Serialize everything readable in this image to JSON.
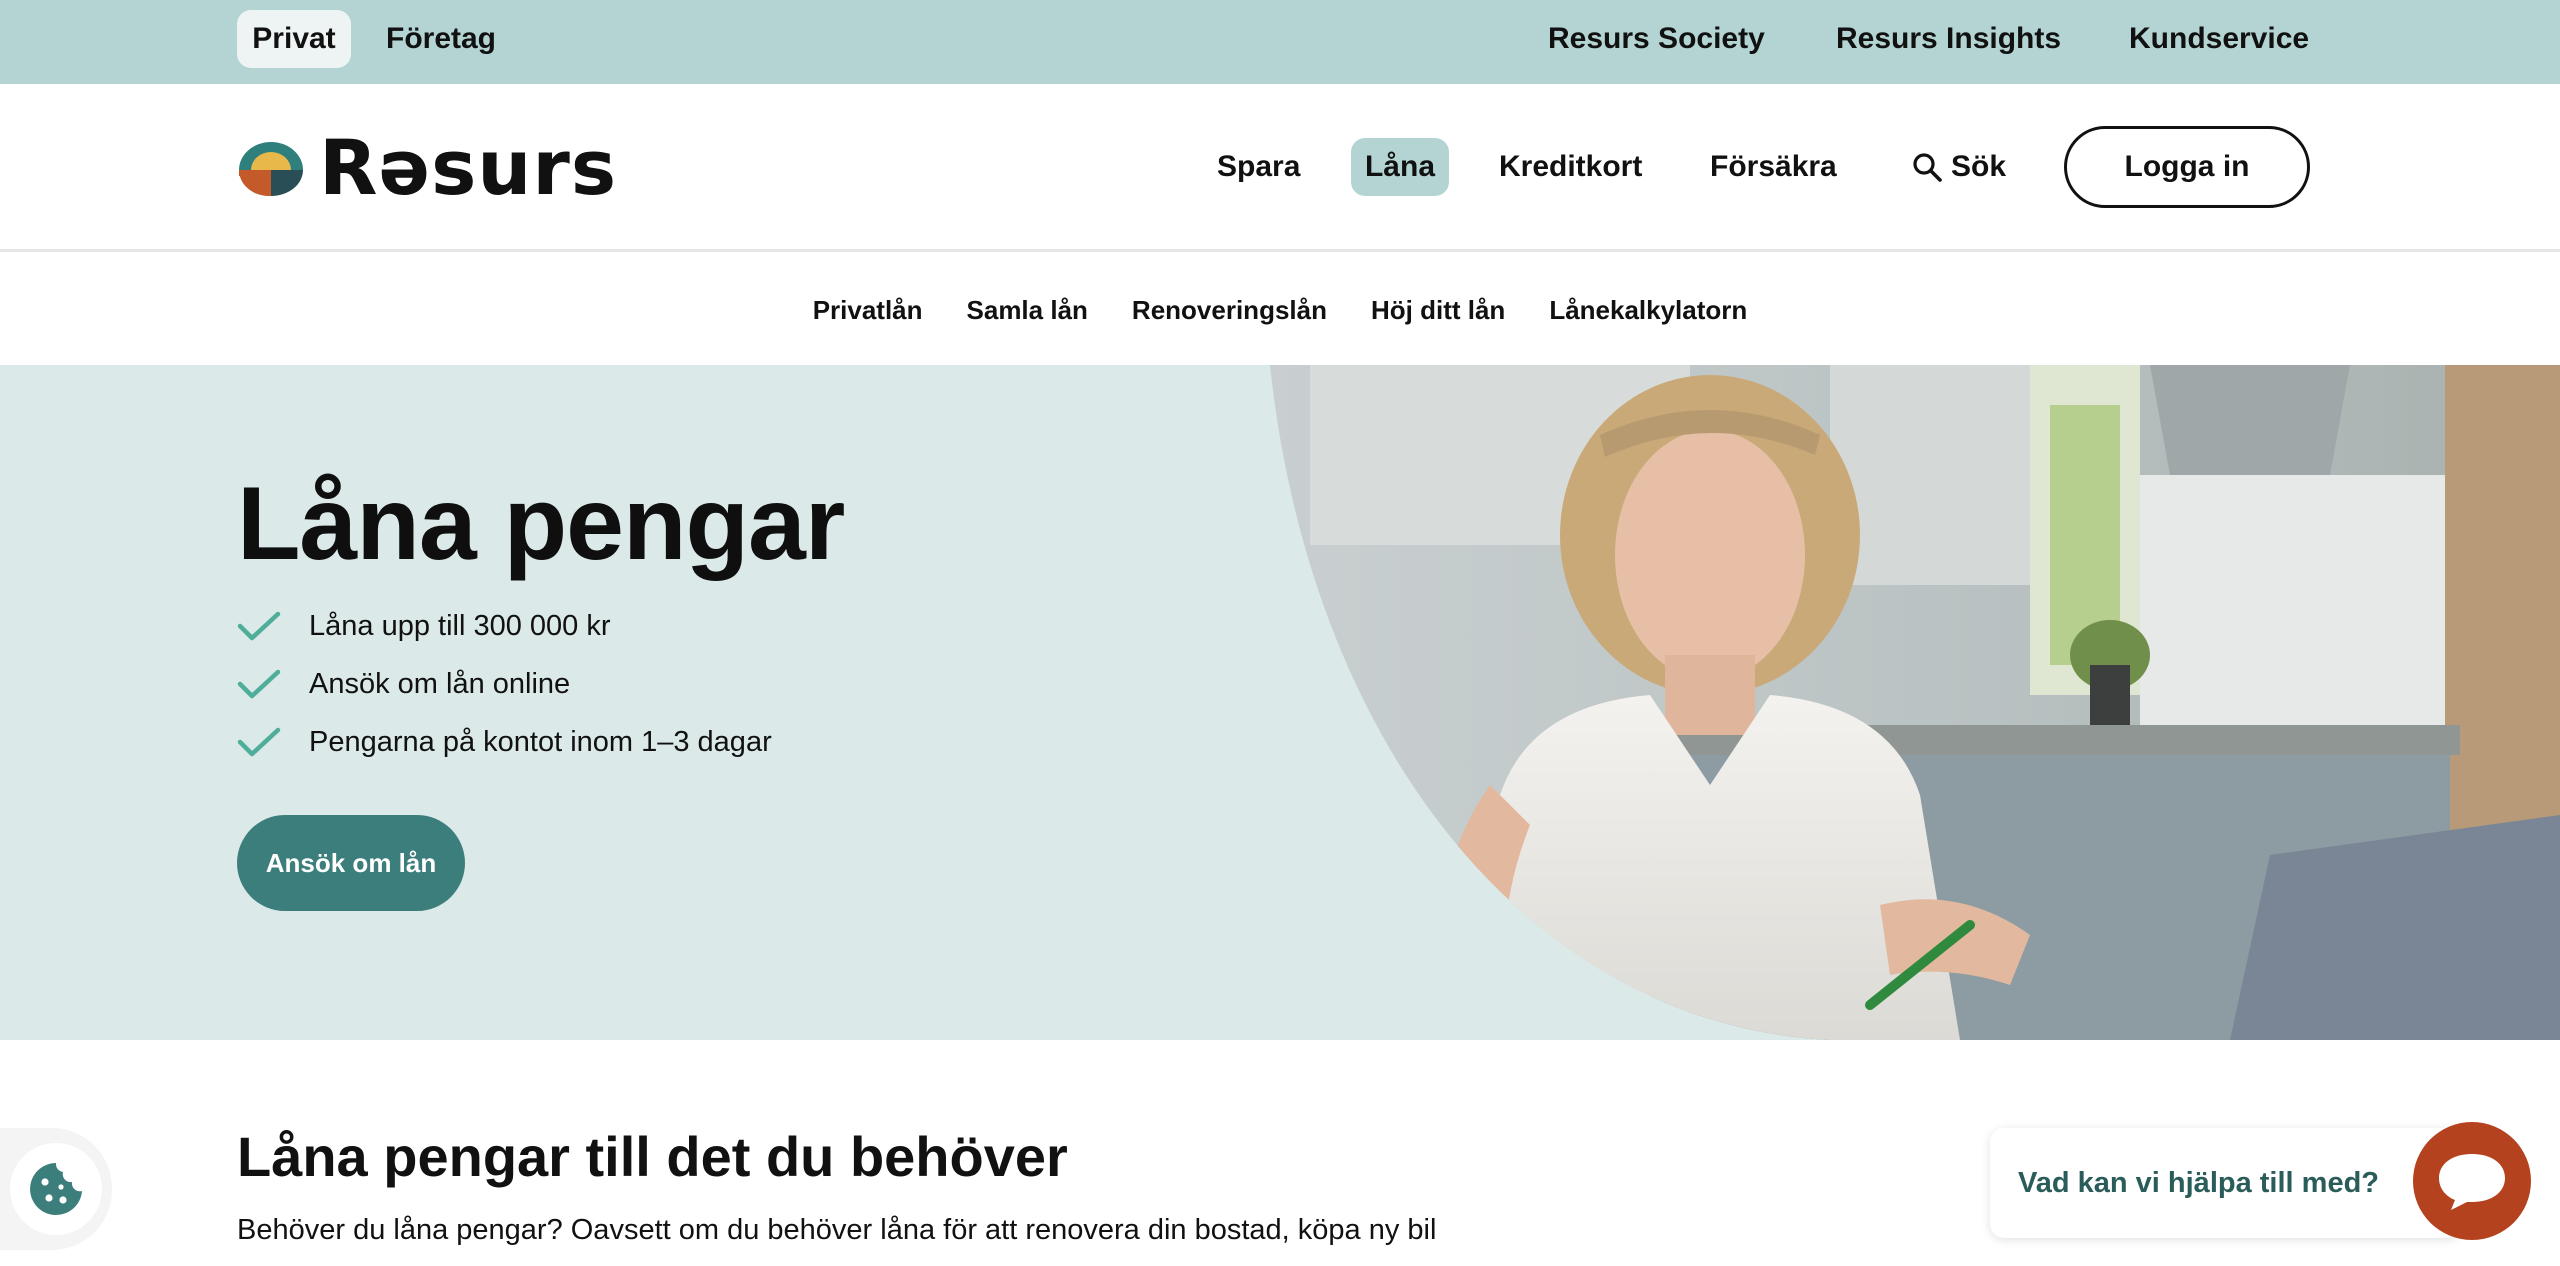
{
  "topbar": {
    "segments": [
      "Privat",
      "Företag"
    ],
    "links": [
      "Resurs Society",
      "Resurs Insights",
      "Kundservice"
    ]
  },
  "header": {
    "logo_text": "Rəsurs",
    "nav": [
      "Spara",
      "Låna",
      "Kreditkort",
      "Försäkra"
    ],
    "search_label": "Sök",
    "login_label": "Logga in"
  },
  "subnav": [
    "Privatlån",
    "Samla lån",
    "Renoveringslån",
    "Höj ditt lån",
    "Lånekalkylatorn"
  ],
  "hero": {
    "title": "Låna pengar",
    "bullets": [
      "Låna upp till 300 000 kr",
      "Ansök om lån online",
      "Pengarna på kontot inom 1–3 dagar"
    ],
    "cta": "Ansök om lån"
  },
  "content": {
    "title": "Låna pengar till det du behöver",
    "text": "Behöver du låna pengar? Oavsett om du behöver låna för att renovera din bostad, köpa ny bil"
  },
  "chat": {
    "prompt": "Vad kan vi hjälpa till med?"
  },
  "colors": {
    "topbar": "#b3d4d3",
    "hero_bg": "#dbe9e8",
    "accent": "#3b7e7b",
    "check": "#4fae9a",
    "chat": "#b4421f"
  },
  "icons": {
    "search": "search-icon",
    "check": "check-icon",
    "cookie": "cookie-icon",
    "chat": "chat-icon"
  }
}
